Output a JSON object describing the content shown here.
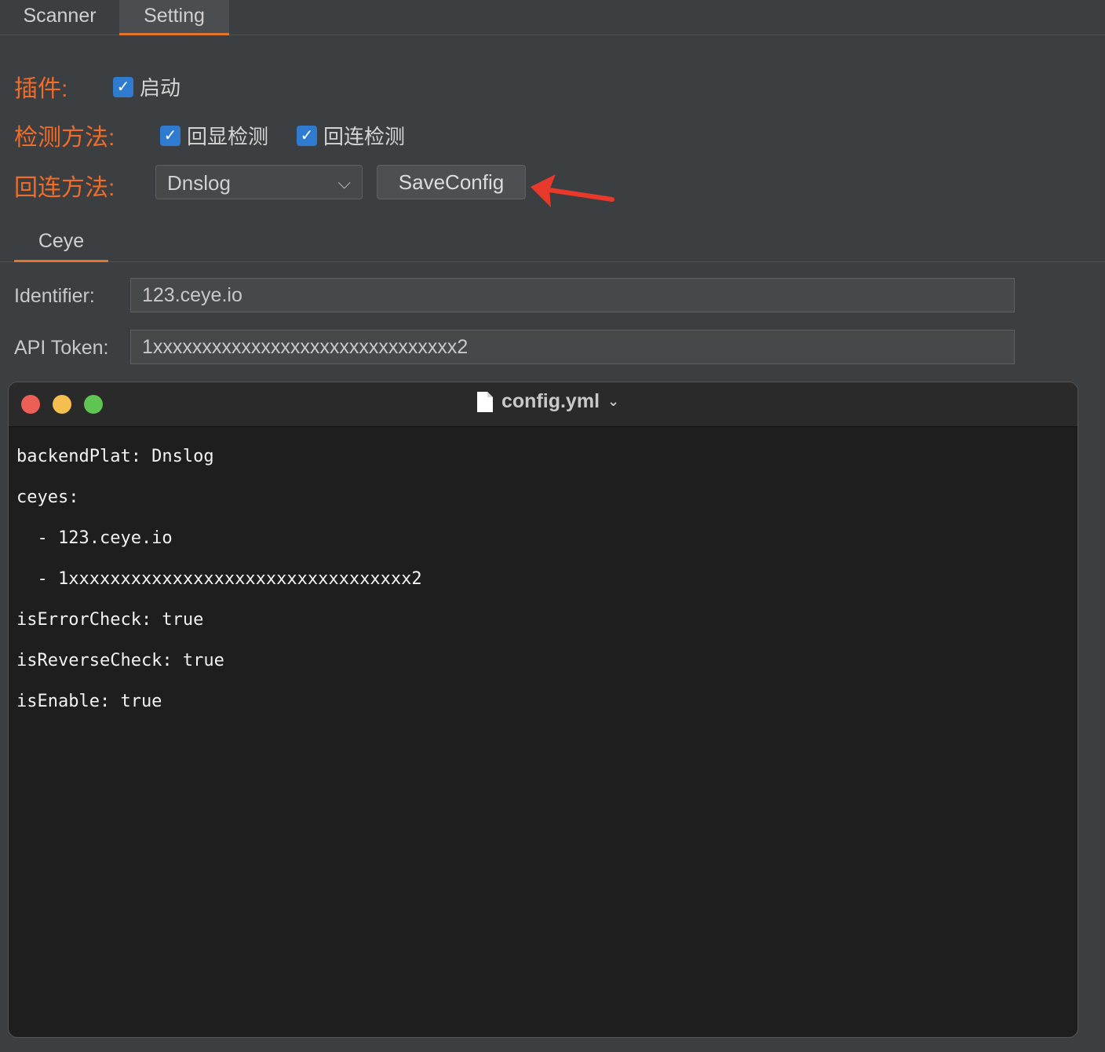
{
  "tabs": {
    "scanner": "Scanner",
    "setting": "Setting"
  },
  "settings": {
    "plugin_label": "插件:",
    "plugin_enable": "启动",
    "detect_label": "检测方法:",
    "detect_echo": "回显检测",
    "detect_reverse": "回连检测",
    "reverse_label": "回连方法:",
    "reverse_value": "Dnslog",
    "save_button": "SaveConfig"
  },
  "ceye": {
    "tab": "Ceye",
    "identifier_label": "Identifier:",
    "identifier_value": "123.ceye.io",
    "token_label": "API Token:",
    "token_value": "1xxxxxxxxxxxxxxxxxxxxxxxxxxxxxxx2"
  },
  "terminal": {
    "title": "config.yml",
    "lines": [
      "backendPlat: Dnslog",
      "ceyes:",
      "  - 123.ceye.io",
      "  - 1xxxxxxxxxxxxxxxxxxxxxxxxxxxxxxxxx2",
      "isErrorCheck: true",
      "isReverseCheck: true",
      "isEnable: true"
    ]
  },
  "colors": {
    "accent_orange": "#f06c2a",
    "checkbox_blue": "#2f7bd0",
    "arrow_red": "#e8392a"
  },
  "icons": {
    "checkbox": "checkmark-icon",
    "dropdown": "chevron-down-icon",
    "annotation": "red-arrow-icon",
    "file": "file-icon"
  }
}
